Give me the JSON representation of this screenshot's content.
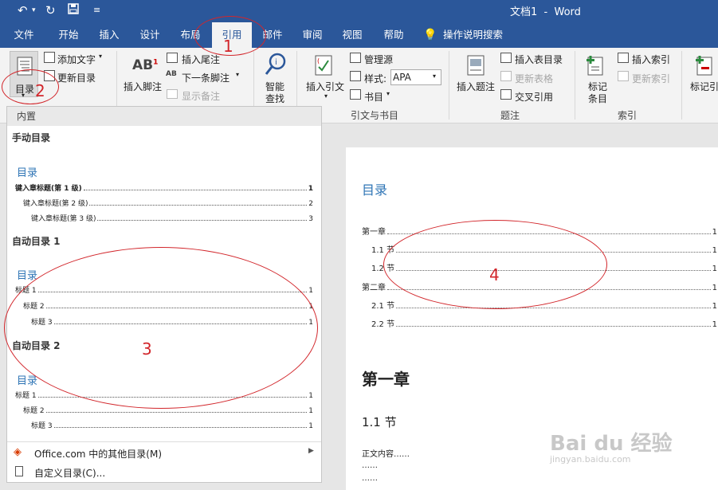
{
  "title_bar": {
    "doc_name": "文档1",
    "separator": "-",
    "app_name": "Word"
  },
  "tabs": [
    "文件",
    "开始",
    "插入",
    "设计",
    "布局",
    "引用",
    "邮件",
    "审阅",
    "视图",
    "帮助"
  ],
  "tell_me": "操作说明搜索",
  "ribbon": {
    "toc_button": "目录",
    "add_text": "添加文字",
    "update_toc": "更新目录",
    "insert_footnote": "插入脚注",
    "insert_endnote": "插入尾注",
    "next_footnote": "下一条脚注",
    "show_notes": "显示备注",
    "smart_lookup_1": "智能",
    "smart_lookup_2": "查找",
    "insert_citation": "插入引文",
    "manage_sources": "管理源",
    "style_label": "样式:",
    "style_value": "APA",
    "bibliography": "书目",
    "group_citations": "引文与书目",
    "insert_caption": "插入题注",
    "insert_table_of_figures": "插入表目录",
    "update_table": "更新表格",
    "cross_reference": "交叉引用",
    "group_captions": "题注",
    "mark_entry_1": "标记",
    "mark_entry_2": "条目",
    "insert_index": "插入索引",
    "update_index": "更新索引",
    "group_index": "索引",
    "mark_citation": "标记引"
  },
  "dropdown": {
    "section": "内置",
    "manual_heading": "手动目录",
    "manual_title": "目录",
    "manual_lines": [
      {
        "text": "键入章标题(第 1 级)",
        "num": "1"
      },
      {
        "text": "键入章标题(第 2 级)",
        "num": "2"
      },
      {
        "text": "键入章标题(第 3 级)",
        "num": "3"
      }
    ],
    "auto1_heading": "自动目录 1",
    "auto1_title": "目录",
    "auto1_lines": [
      {
        "text": "标题 1",
        "num": "1"
      },
      {
        "text": "标题 2",
        "num": "1"
      },
      {
        "text": "标题 3",
        "num": "1"
      }
    ],
    "auto2_heading": "自动目录 2",
    "auto2_title": "目录",
    "auto2_lines": [
      {
        "text": "标题 1",
        "num": "1"
      },
      {
        "text": "标题 2",
        "num": "1"
      },
      {
        "text": "标题 3",
        "num": "1"
      }
    ],
    "more_office": "Office.com 中的其他目录(M)",
    "custom_toc": "自定义目录(C)..."
  },
  "document": {
    "toc_title": "目录",
    "toc_lines": [
      {
        "text": "第一章",
        "num": "1"
      },
      {
        "text": "1.1 节",
        "num": "1"
      },
      {
        "text": "1.2 节",
        "num": "1"
      },
      {
        "text": "第二章",
        "num": "1"
      },
      {
        "text": "2.1 节",
        "num": "1"
      },
      {
        "text": "2.2 节",
        "num": "1"
      }
    ],
    "heading1": "第一章",
    "heading2": "1.1 节",
    "body1": "正文内容……",
    "body2": "……",
    "body3": "……"
  },
  "annotations": [
    "1",
    "2",
    "3",
    "4"
  ],
  "watermark": {
    "main": "Bai du 经验",
    "sub": "jingyan.baidu.com"
  }
}
